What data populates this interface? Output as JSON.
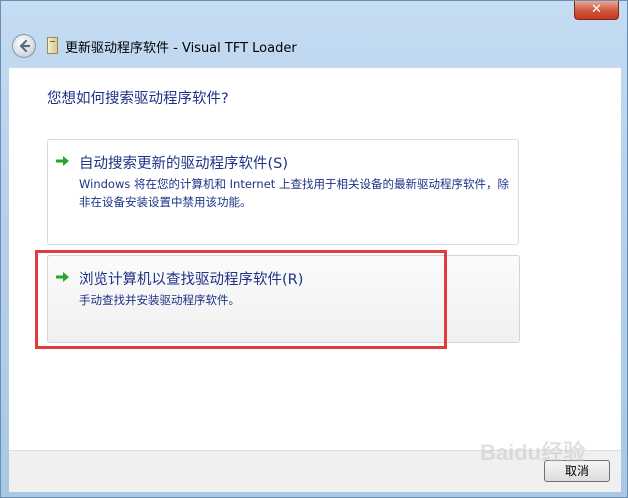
{
  "window": {
    "title": "更新驱动程序软件 - Visual TFT Loader",
    "close_label": "✕"
  },
  "main": {
    "question": "您想如何搜索驱动程序软件?",
    "options": [
      {
        "title": "自动搜索更新的驱动程序软件(S)",
        "description": "Windows 将在您的计算机和 Internet 上查找用于相关设备的最新驱动程序软件，除非在设备安装设置中禁用该功能。"
      },
      {
        "title": "浏览计算机以查找驱动程序软件(R)",
        "description": "手动查找并安装驱动程序软件。"
      }
    ]
  },
  "footer": {
    "cancel_label": "取消"
  },
  "watermark": "Baidu经验",
  "colors": {
    "link_blue": "#1e3287",
    "highlight_red": "#e23b3b",
    "arrow_green": "#2aa52a"
  }
}
